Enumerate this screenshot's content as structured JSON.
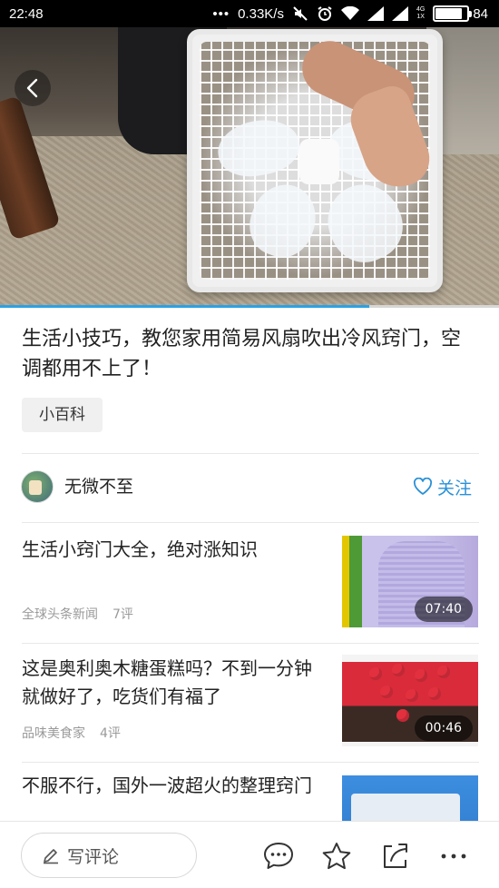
{
  "status_bar": {
    "time": "22:48",
    "net_speed": "0.33K/s",
    "net_type_top": "4G",
    "net_type_bottom": "1X",
    "battery_level": "84",
    "battery_fraction": 0.84
  },
  "video": {
    "progress_fraction": 0.74
  },
  "article": {
    "title": "生活小技巧，教您家用简易风扇吹出冷风窍门，空调都用不上了！",
    "tag": "小百科"
  },
  "author": {
    "name": "无微不至",
    "follow_label": "关注"
  },
  "related": [
    {
      "title": "生活小窍门大全，绝对涨知识",
      "source": "全球头条新闻",
      "comments": "7评",
      "duration": "07:40"
    },
    {
      "title": "这是奥利奥木糖蛋糕吗？不到一分钟就做好了，吃货们有福了",
      "source": "品味美食家",
      "comments": "4评",
      "duration": "00:46"
    },
    {
      "title": "不服不行，国外一波超火的整理窍门"
    }
  ],
  "bottom_bar": {
    "comment_placeholder": "写评论",
    "icons": [
      "comment-icon",
      "star-icon",
      "share-icon",
      "more-icon"
    ]
  },
  "colors": {
    "accent": "#2a90d7",
    "progress": "#2aa2e8"
  }
}
